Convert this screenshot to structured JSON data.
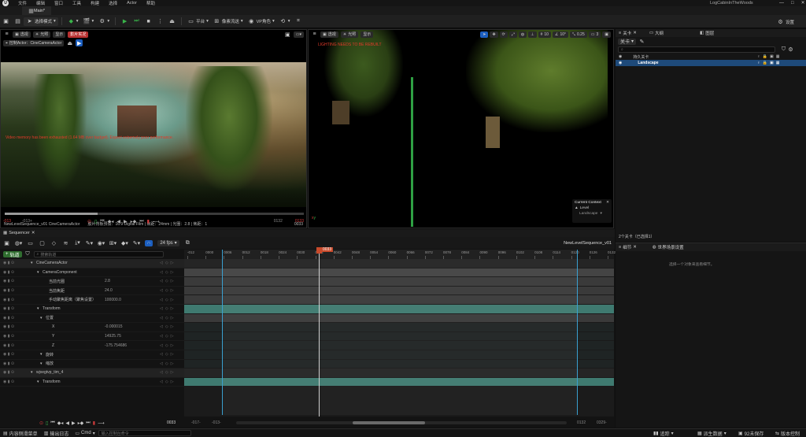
{
  "title_bar": {
    "menus": [
      "文件",
      "编辑",
      "窗口",
      "工具",
      "构建",
      "选择",
      "Actor",
      "帮助"
    ],
    "project_name": "LogCabinInTheWoods"
  },
  "tabs": [
    {
      "label": "Main*"
    }
  ],
  "toolbar": {
    "mode_label": "选择模式",
    "platform_label": "平台",
    "scalability_label": "像素流送",
    "vp_label": "VP角色",
    "settings_label": "设置"
  },
  "cine_viewport": {
    "btn_perspective": "透视",
    "btn_lit": "光照",
    "btn_show": "显示",
    "btn_live": "影片实况",
    "pilot_label": "控制Actor：CineCameraActor",
    "warning": "Video memory has been exhausted (1.64 MB over budget). Expect extremely poor performance.",
    "info_left": "NewLevelSequence_v01  CineCameraActor",
    "info_mid": "胶片背板预设：16:9 Digital Film | 焦距：24mm | 光圈：2.8 | 焦距：1",
    "info_right": "0033",
    "frame_start": "-013",
    "frame_begin": "-013+",
    "frame_end": "0132",
    "frame_end2": "0133"
  },
  "level_viewport": {
    "btn_perspective": "透视",
    "btn_lit": "光照",
    "btn_show": "显示",
    "warning": "LIGHTING NEEDS TO BE REBUILT",
    "snap_grid": "10",
    "snap_angle": "10°",
    "snap_scale": "0.25",
    "cam_speed": "3",
    "context_title": "Current Context",
    "context_level": "Level",
    "context_landscape": "Landscape"
  },
  "outliner": {
    "tab1": "关卡",
    "tab2": "大纲",
    "tab3": "图层",
    "search_placeholder": "关卡",
    "col_name": "持久关卡",
    "row_landscape": "Landscape",
    "footer": "2个关卡（已选择1）"
  },
  "details": {
    "tab1": "细节",
    "tab2": "世界场景设置",
    "empty_msg": "选择一个对象来查看细节。"
  },
  "sequencer": {
    "tab_label": "Sequencer",
    "fps": "24 fps",
    "sequence_name": "NewLevelSequence_v01",
    "current_frame": "0033",
    "search_placeholder": "搜索轨道",
    "add_label": "轨道",
    "tracks": [
      {
        "label": "CineCameraActor",
        "indent": 46,
        "value": "",
        "type": "actor"
      },
      {
        "label": "CameraComponent",
        "indent": 54,
        "value": "",
        "type": "comp"
      },
      {
        "label": "当前光圈",
        "indent": 62,
        "value": "2.8",
        "type": "prop"
      },
      {
        "label": "当前焦距",
        "indent": 62,
        "value": "24.0",
        "type": "prop"
      },
      {
        "label": "手动聚焦距离（聚焦设置）",
        "indent": 62,
        "value": "100000.0",
        "type": "prop"
      },
      {
        "label": "Transform",
        "indent": 54,
        "value": "",
        "type": "transform"
      },
      {
        "label": "位置",
        "indent": 58,
        "value": "",
        "type": "group"
      },
      {
        "label": "X",
        "indent": 66,
        "value": "-0.000015",
        "type": "prop"
      },
      {
        "label": "Y",
        "indent": 66,
        "value": "14925.75",
        "type": "prop"
      },
      {
        "label": "Z",
        "indent": 66,
        "value": "-175.754686",
        "type": "prop"
      },
      {
        "label": "旋转",
        "indent": 58,
        "value": "",
        "type": "group"
      },
      {
        "label": "缩放",
        "indent": 58,
        "value": "",
        "type": "group"
      },
      {
        "label": "wjxegtvp_tim_4",
        "indent": 46,
        "value": "",
        "type": "actor2"
      },
      {
        "label": "Transform",
        "indent": 54,
        "value": "",
        "type": "transform"
      }
    ],
    "ruler_ticks": [
      "-012",
      "0000",
      "0006",
      "0012",
      "0018",
      "0024",
      "0030",
      "0036",
      "0042",
      "0048",
      "0054",
      "0060",
      "0066",
      "0072",
      "0078",
      "0084",
      "0090",
      "0096",
      "0102",
      "0108",
      "0114",
      "0120",
      "0126",
      "0132"
    ],
    "bottom_start": "-017-",
    "bottom_begin": "-013-",
    "bottom_end": "0132",
    "bottom_end2": "0329-"
  },
  "status_bar": {
    "content_drawer": "内容侧滑菜单",
    "output_log": "输出日志",
    "cmd": "Cmd",
    "cmd_placeholder": "输入控制台命令",
    "trace": "追踪",
    "derived_data": "派生数据",
    "unsaved": "92未保存",
    "source_control": "版本控制"
  },
  "colors": {
    "accent_blue": "#2f8fff",
    "teal_track": "#3f7a70",
    "playhead": "#c84a2b",
    "selection_row": "#1e4a7a"
  }
}
